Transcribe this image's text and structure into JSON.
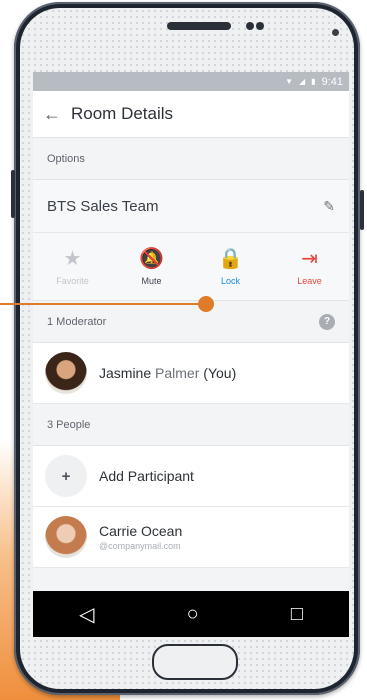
{
  "status": {
    "time": "9:41"
  },
  "appbar": {
    "back_icon": "←",
    "title": "Room Details"
  },
  "options_header": "Options",
  "room": {
    "name": "BTS Sales Team",
    "edit_icon": "pencil-icon"
  },
  "actions": [
    {
      "label": "Favorite",
      "icon": "★"
    },
    {
      "label": "Mute",
      "icon": "🔕"
    },
    {
      "label": "Lock",
      "icon": "🔒"
    },
    {
      "label": "Leave",
      "icon": "⇥"
    }
  ],
  "moderator_header": "1 Moderator",
  "help_badge": "?",
  "moderator": {
    "first": "Jasmine",
    "last": "Palmer",
    "suffix": "(You)"
  },
  "people_header": "3 People",
  "add_participant": {
    "icon": "+",
    "label": "Add Participant"
  },
  "participant": {
    "name": "Carrie Ocean",
    "email": "@companymail.com"
  },
  "nav": {
    "back": "◁",
    "home": "○",
    "recents": "□"
  },
  "colors": {
    "accent": "#1c8de0",
    "danger": "#e8483e",
    "callout": "#e07b2a"
  }
}
